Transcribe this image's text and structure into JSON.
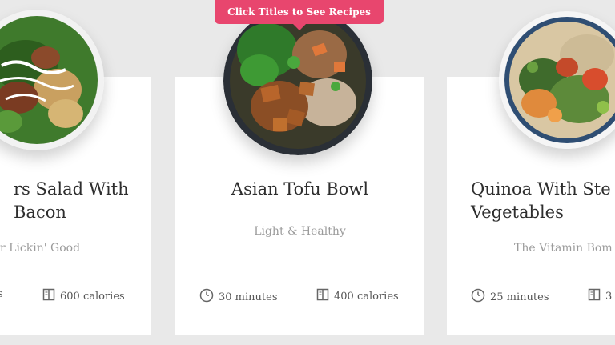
{
  "banner": {
    "label": "Click Titles to See Recipes"
  },
  "colors": {
    "accent": "#e8466e",
    "card_bg": "#ffffff",
    "page_bg": "#e9e9e9"
  },
  "cards": [
    {
      "title": "rs Salad With Bacon",
      "subtitle": "r Lickin' Good",
      "time": "s",
      "calories": "600 calories",
      "image": "salad-plate-image"
    },
    {
      "title": "Asian Tofu Bowl",
      "subtitle": "Light & Healthy",
      "time": "30 minutes",
      "calories": "400 calories",
      "image": "tofu-bowl-image"
    },
    {
      "title": "Quinoa With Ste Vegetables",
      "subtitle": "The Vitamin Bom",
      "time": "25 minutes",
      "calories": "3",
      "image": "quinoa-bowl-image"
    }
  ]
}
